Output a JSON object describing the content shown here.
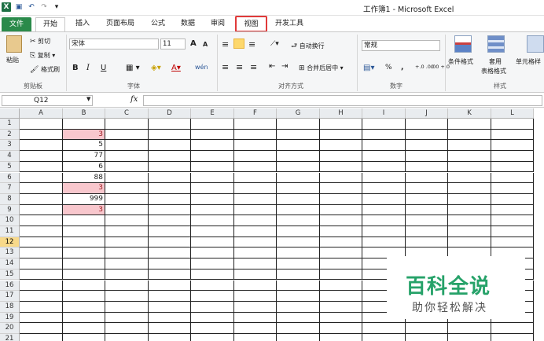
{
  "window": {
    "title": "工作簿1 - Microsoft Excel"
  },
  "qat": {
    "logo": "X",
    "save": "▣",
    "undo": "↶",
    "redo": "↷",
    "custom": "▾"
  },
  "tabs": [
    {
      "id": "file",
      "label": "文件"
    },
    {
      "id": "home",
      "label": "开始"
    },
    {
      "id": "insert",
      "label": "插入"
    },
    {
      "id": "pagelayout",
      "label": "页面布局"
    },
    {
      "id": "formulas",
      "label": "公式"
    },
    {
      "id": "data",
      "label": "数据"
    },
    {
      "id": "review",
      "label": "审阅"
    },
    {
      "id": "view",
      "label": "视图"
    },
    {
      "id": "developer",
      "label": "开发工具"
    }
  ],
  "ribbon": {
    "clipboard": {
      "paste": "粘贴",
      "cut": "剪切",
      "copy": "复制 ▾",
      "format_painter": "格式刷",
      "label": "剪贴板"
    },
    "font": {
      "name": "宋体",
      "size": "11",
      "bold": "B",
      "italic": "I",
      "underline": "U",
      "grow": "A",
      "shrink": "A",
      "label": "字体",
      "phonetic": "wén"
    },
    "alignment": {
      "wrap": "自动换行",
      "merge": "合并后居中 ▾",
      "label": "对齐方式"
    },
    "number": {
      "format": "常规",
      "percent": "%",
      "comma": ",",
      "inc_dec": "+.0 .00",
      "dec_dec": ".00 +.0",
      "label": "数字"
    },
    "styles": {
      "cond_format": "条件格式",
      "table_format_1": "套用",
      "table_format_2": "表格格式",
      "cell_styles": "单元格样",
      "label": "样式"
    }
  },
  "formula_bar": {
    "name_box": "Q12",
    "fx": "fx",
    "content": ""
  },
  "columns": [
    "A",
    "B",
    "C",
    "D",
    "E",
    "F",
    "G",
    "H",
    "I",
    "J",
    "K",
    "L"
  ],
  "rows": [
    "1",
    "2",
    "3",
    "4",
    "5",
    "6",
    "7",
    "8",
    "9",
    "10",
    "11",
    "12",
    "13",
    "14",
    "15",
    "16",
    "17",
    "18",
    "19",
    "20",
    "21"
  ],
  "active_row": "12",
  "column_b": [
    "",
    "3",
    "5",
    "77",
    "6",
    "88",
    "3",
    "999",
    "3"
  ],
  "highlight_color": "#f8c7cd",
  "watermark": {
    "title": "百科全说",
    "subtitle": "助你轻松解决"
  }
}
